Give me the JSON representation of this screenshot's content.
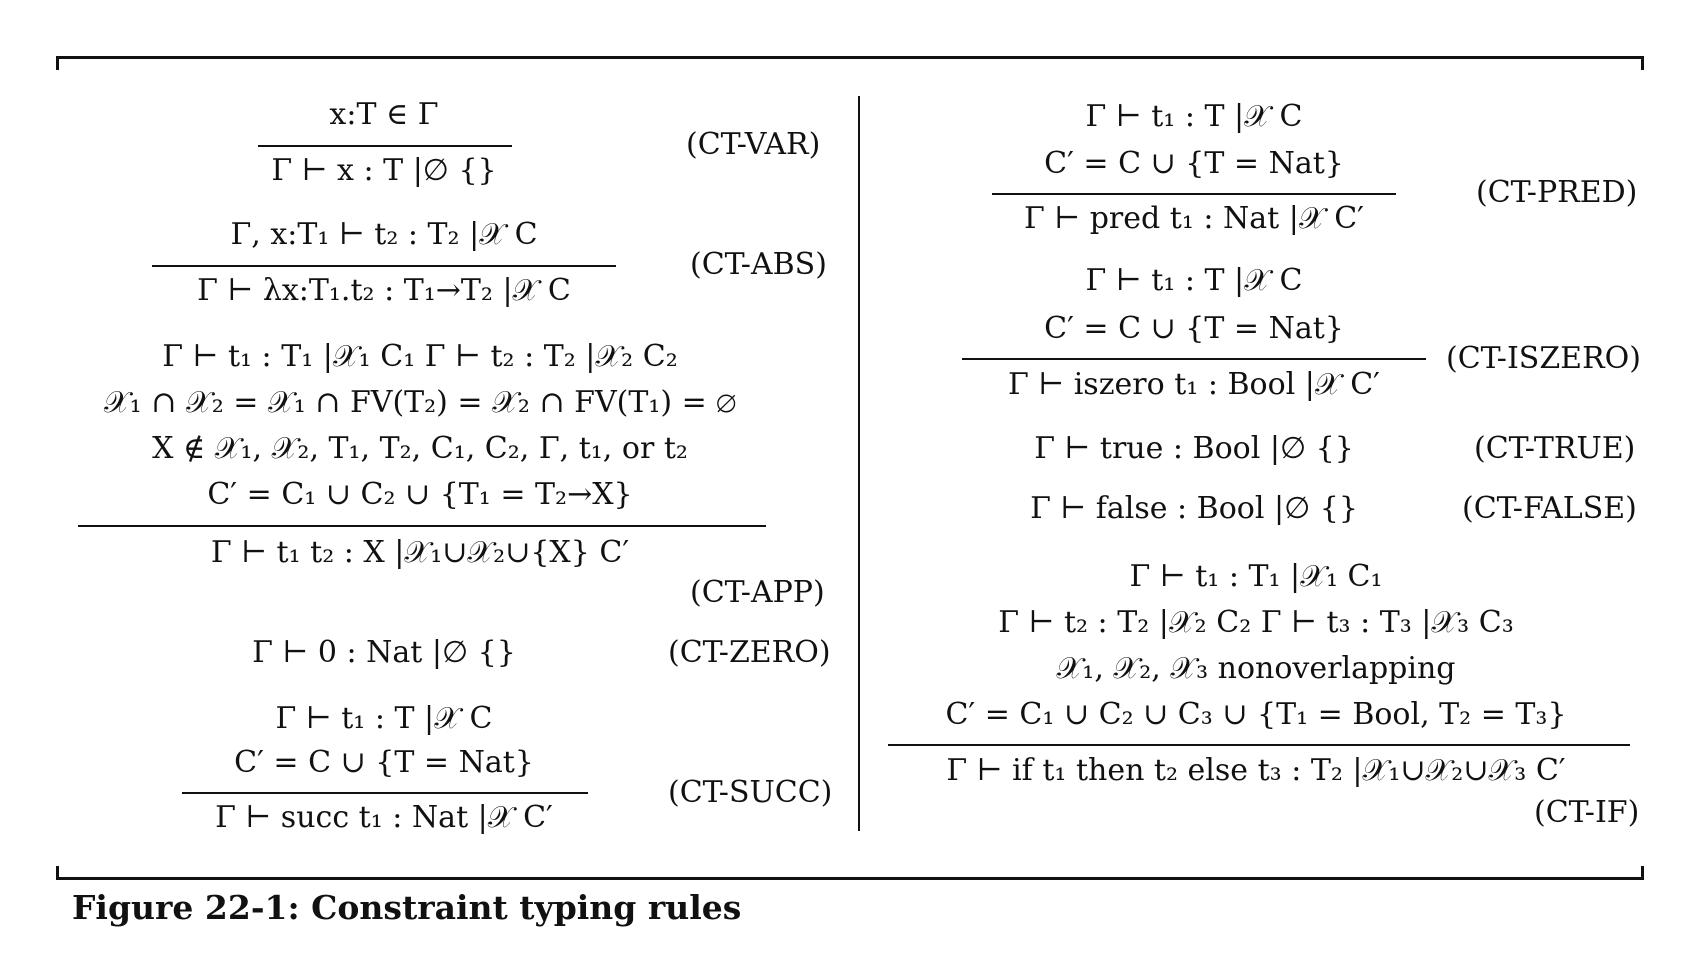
{
  "rules": [
    {
      "label": "(CT-VAR)",
      "premises": [
        "x:T ∈ Γ"
      ],
      "conclusion": "Γ ⊢ x : T  |∅ {}"
    },
    {
      "label": "(CT-ABS)",
      "premises": [
        "Γ, x:T₁ ⊢ t₂ : T₂  |𝒳 C"
      ],
      "conclusion": "Γ ⊢ λx:T₁.t₂ : T₁→T₂  |𝒳 C"
    },
    {
      "label": "(CT-APP)",
      "premises": [
        "Γ ⊢ t₁ : T₁  |𝒳₁ C₁       Γ ⊢ t₂ : T₂  |𝒳₂ C₂",
        "𝒳₁ ∩ 𝒳₂ = 𝒳₁ ∩ FV(T₂) = 𝒳₂ ∩ FV(T₁) = ∅",
        "X ∉ 𝒳₁, 𝒳₂, T₁, T₂, C₁, C₂, Γ, t₁, or t₂",
        "C′ = C₁ ∪ C₂ ∪ {T₁ = T₂→X}"
      ],
      "conclusion": "Γ ⊢ t₁ t₂ : X  |𝒳₁∪𝒳₂∪{X} C′"
    },
    {
      "label": "(CT-ZERO)",
      "premises": [],
      "conclusion": "Γ ⊢ 0 : Nat  |∅ {}"
    },
    {
      "label": "(CT-SUCC)",
      "premises": [
        "Γ ⊢ t₁ : T  |𝒳 C",
        "C′ = C ∪ {T = Nat}"
      ],
      "conclusion": "Γ ⊢ succ t₁ : Nat  |𝒳 C′"
    },
    {
      "label": "(CT-PRED)",
      "premises": [
        "Γ ⊢ t₁ : T  |𝒳 C",
        "C′ = C ∪ {T = Nat}"
      ],
      "conclusion": "Γ ⊢ pred t₁ : Nat  |𝒳 C′"
    },
    {
      "label": "(CT-ISZERO)",
      "premises": [
        "Γ ⊢ t₁ : T  |𝒳 C",
        "C′ = C ∪ {T = Nat}"
      ],
      "conclusion": "Γ ⊢ iszero t₁ : Bool  |𝒳 C′"
    },
    {
      "label": "(CT-TRUE)",
      "premises": [],
      "conclusion": "Γ ⊢ true : Bool  |∅ {}"
    },
    {
      "label": "(CT-FALSE)",
      "premises": [],
      "conclusion": "Γ ⊢ false : Bool  |∅ {}"
    },
    {
      "label": "(CT-IF)",
      "premises": [
        "Γ ⊢ t₁ : T₁  |𝒳₁ C₁",
        "Γ ⊢ t₂ : T₂  |𝒳₂ C₂       Γ ⊢ t₃ : T₃  |𝒳₃ C₃",
        "𝒳₁, 𝒳₂, 𝒳₃ nonoverlapping",
        "C′ = C₁ ∪ C₂ ∪ C₃ ∪ {T₁ = Bool, T₂ = T₃}"
      ],
      "conclusion": "Γ ⊢ if t₁ then t₂ else t₃ : T₂  |𝒳₁∪𝒳₂∪𝒳₃ C′"
    }
  ],
  "caption": "Figure 22-1: Constraint typing rules"
}
